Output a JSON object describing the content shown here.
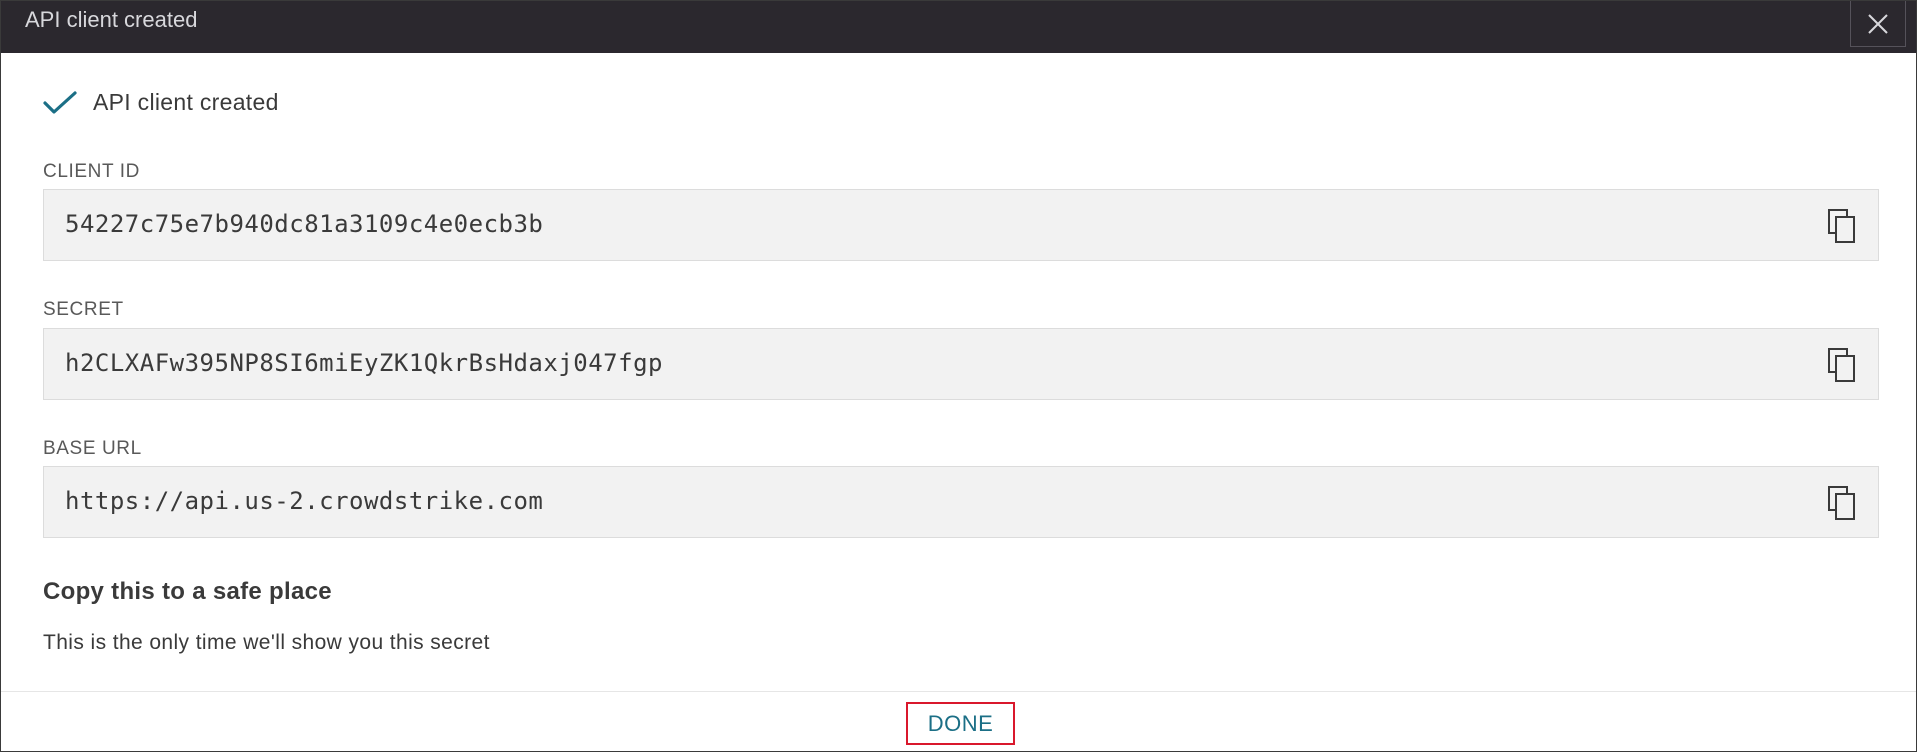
{
  "dialog": {
    "title": "API client created",
    "close_icon": "close-icon"
  },
  "status": {
    "icon": "checkmark-icon",
    "text": "API client created",
    "icon_color": "#1b6f86"
  },
  "fields": [
    {
      "label": "CLIENT ID",
      "value": "54227c75e7b940dc81a3109c4e0ecb3b",
      "copy_icon": "copy-icon"
    },
    {
      "label": "SECRET",
      "value": "h2CLXAFw395NP8SI6miEyZK1QkrBsHdaxj047fgp",
      "copy_icon": "copy-icon"
    },
    {
      "label": "BASE URL",
      "value": "https://api.us-2.crowdstrike.com",
      "copy_icon": "copy-icon"
    }
  ],
  "notice": {
    "heading": "Copy this to a safe place",
    "text": "This is the only time we'll show you this secret"
  },
  "footer": {
    "done_label": "DONE"
  },
  "colors": {
    "titlebar": "#2b282e",
    "accent": "#1b6f86",
    "highlight_border": "#d9182c"
  }
}
